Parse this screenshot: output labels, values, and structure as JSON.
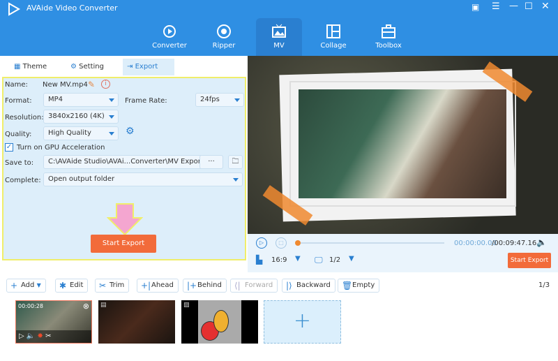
{
  "app": {
    "title": "AVAide Video Converter"
  },
  "nav": [
    {
      "label": "Converter",
      "icon": "converter-icon"
    },
    {
      "label": "Ripper",
      "icon": "ripper-icon"
    },
    {
      "label": "MV",
      "icon": "mv-icon",
      "active": true
    },
    {
      "label": "Collage",
      "icon": "collage-icon"
    },
    {
      "label": "Toolbox",
      "icon": "toolbox-icon"
    }
  ],
  "tabs": [
    {
      "label": "Theme"
    },
    {
      "label": "Setting"
    },
    {
      "label": "Export",
      "active": true
    }
  ],
  "form": {
    "name_label": "Name:",
    "name_value": "New MV.mp4",
    "format_label": "Format:",
    "format_value": "MP4",
    "framerate_label": "Frame Rate:",
    "framerate_value": "24fps",
    "resolution_label": "Resolution:",
    "resolution_value": "3840x2160 (4K)",
    "quality_label": "Quality:",
    "quality_value": "High Quality",
    "gpu_label": "Turn on GPU Acceleration",
    "gpu_checked": true,
    "saveto_label": "Save to:",
    "saveto_value": "C:\\AVAide Studio\\AVAi...Converter\\MV Exported",
    "browse_label": "···",
    "complete_label": "Complete:",
    "complete_value": "Open output folder",
    "start_export": "Start Export"
  },
  "player": {
    "current": "00:00:00.00",
    "total": "/00:09:47.16",
    "aspect": "16:9",
    "screen": "1/2",
    "start_export": "Start Export",
    "progress": 0
  },
  "toolbar": {
    "add": "Add",
    "edit": "Edit",
    "trim": "Trim",
    "ahead": "Ahead",
    "behind": "Behind",
    "forward": "Forward",
    "backward": "Backward",
    "empty": "Empty",
    "page": "1/3"
  },
  "clips": [
    {
      "duration": "00:00:28"
    }
  ],
  "colors": {
    "brand": "#2f8fe3",
    "accent": "#f26b3a",
    "highlight": "#f0ee6a"
  }
}
